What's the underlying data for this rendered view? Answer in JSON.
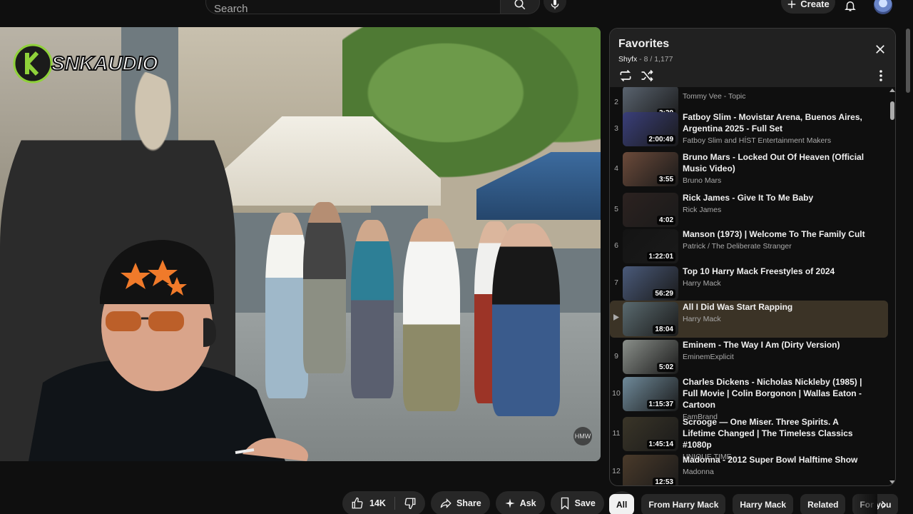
{
  "header": {
    "search_placeholder": "Search",
    "create_label": "Create"
  },
  "video": {
    "overlay_logo_text": "SNKAUDIO",
    "watermark_text": "HMW"
  },
  "actions": {
    "like_count": "14K",
    "share_label": "Share",
    "ask_label": "Ask",
    "save_label": "Save"
  },
  "playlist": {
    "title": "Favorites",
    "owner": "Shyfx",
    "position": "8 / 1,177",
    "items": [
      {
        "index": "2",
        "title": "",
        "channel": "Tommy Vee - Topic",
        "duration": "2:29",
        "thumb_color": "#5a6470"
      },
      {
        "index": "3",
        "title": "Fatboy Slim - Movistar Arena, Buenos Aires, Argentina 2025 - Full Set",
        "channel": "Fatboy Slim and HÍST Entertainment Makers",
        "duration": "2:00:49",
        "thumb_color": "#3a3f7a"
      },
      {
        "index": "4",
        "title": "Bruno Mars - Locked Out Of Heaven (Official Music Video)",
        "channel": "Bruno Mars",
        "duration": "3:55",
        "thumb_color": "#6b4a3a"
      },
      {
        "index": "5",
        "title": "Rick James - Give It To Me Baby",
        "channel": "Rick James",
        "duration": "4:02",
        "thumb_color": "#2c2220"
      },
      {
        "index": "6",
        "title": "Manson (1973) | Welcome To The Family Cult",
        "channel": "Patrick / The Deliberate Stranger",
        "duration": "1:22:01",
        "thumb_color": "#141414"
      },
      {
        "index": "7",
        "title": "Top 10 Harry Mack Freestyles of 2024",
        "channel": "Harry Mack",
        "duration": "56:29",
        "thumb_color": "#4a5a7a"
      },
      {
        "index": "",
        "title": "All I Did Was Start Rapping",
        "channel": "Harry Mack",
        "duration": "18:04",
        "thumb_color": "#5a6a6f"
      },
      {
        "index": "9",
        "title": "Eminem - The Way I Am (Dirty Version)",
        "channel": "EminemExplicit",
        "duration": "5:02",
        "thumb_color": "#8a8f8a"
      },
      {
        "index": "10",
        "title": "Charles Dickens - Nicholas Nickleby (1985) | Full Movie | Colin Borgonon | Wallas Eaton - Cartoon",
        "channel": "FamBrand",
        "duration": "1:15:37",
        "thumb_color": "#6f8a9a"
      },
      {
        "index": "11",
        "title": "Scrooge — One Miser. Three Spirits. A Lifetime Changed | The Timeless Classics #1080p",
        "channel": "UNIQUE TIME",
        "duration": "1:45:14",
        "thumb_color": "#3a3528"
      },
      {
        "index": "12",
        "title": "Madonna - 2012 Super Bowl Halftime Show",
        "channel": "Madonna",
        "duration": "12:53",
        "thumb_color": "#4a3a2a"
      }
    ]
  },
  "chips": [
    "All",
    "From Harry Mack",
    "Harry Mack",
    "Related",
    "For you"
  ],
  "colors": {
    "accent": "#f1f1f1",
    "active_row": "#3b3326",
    "background": "#0f0f0f"
  }
}
